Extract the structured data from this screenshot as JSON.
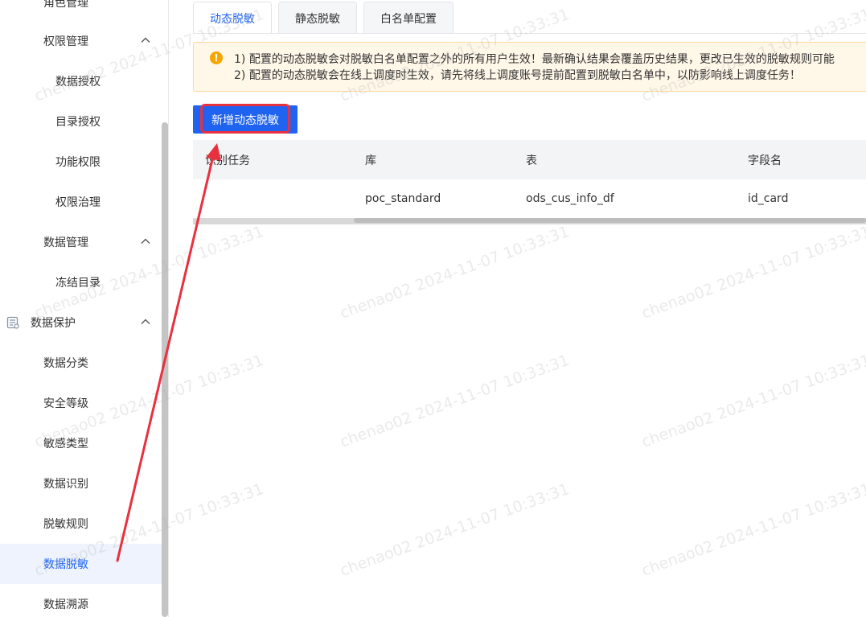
{
  "sidebar": {
    "items": [
      {
        "label": "角色管理",
        "level": 1
      },
      {
        "label": "权限管理",
        "level": 1,
        "expandable": true
      },
      {
        "label": "数据授权",
        "level": 2
      },
      {
        "label": "目录授权",
        "level": 2
      },
      {
        "label": "功能权限",
        "level": 2
      },
      {
        "label": "权限治理",
        "level": 2
      },
      {
        "label": "数据管理",
        "level": 1,
        "expandable": true
      },
      {
        "label": "冻结目录",
        "level": 2
      },
      {
        "label": "数据保护",
        "level": 0,
        "expandable": true,
        "icon": "document-list-icon"
      },
      {
        "label": "数据分类",
        "level": 1
      },
      {
        "label": "安全等级",
        "level": 1
      },
      {
        "label": "敏感类型",
        "level": 1
      },
      {
        "label": "数据识别",
        "level": 1
      },
      {
        "label": "脱敏规则",
        "level": 1
      },
      {
        "label": "数据脱敏",
        "level": 1,
        "active": true
      },
      {
        "label": "数据溯源",
        "level": 1
      }
    ]
  },
  "tabs": [
    {
      "label": "动态脱敏",
      "active": true
    },
    {
      "label": "静态脱敏"
    },
    {
      "label": "白名单配置"
    }
  ],
  "alert": {
    "icon": "warning-icon",
    "line1": "1) 配置的动态脱敏会对脱敏白名单配置之外的所有用户生效！最新确认结果会覆盖历史结果，更改已生效的脱敏规则可能",
    "line2": "2) 配置的动态脱敏会在线上调度时生效，请先将线上调度账号提前配置到脱敏白名单中，以防影响线上调度任务！"
  },
  "toolbar": {
    "add_label": "新增动态脱敏"
  },
  "table": {
    "headers": [
      "识别任务",
      "库",
      "表",
      "字段名"
    ],
    "rows": [
      [
        "",
        "poc_standard",
        "ods_cus_info_df",
        "id_card"
      ]
    ]
  },
  "watermark": "chenao02 2024-11-07 10:33:31",
  "colors": {
    "primary": "#1f63f0",
    "highlight": "#e8313f",
    "alert_bg": "#fff7e8",
    "alert_border": "#ffd99a",
    "warning": "#f7a600"
  }
}
